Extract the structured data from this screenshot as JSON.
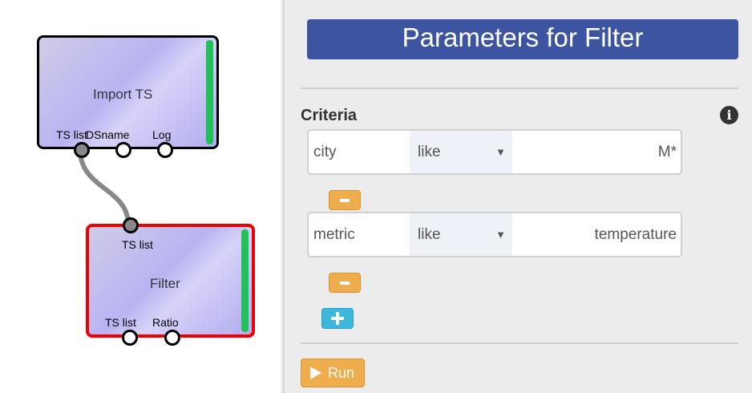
{
  "graph": {
    "nodes": [
      {
        "title": "Import TS",
        "ports_out": [
          "TS list",
          "DSname",
          "Log"
        ]
      },
      {
        "title": "Filter",
        "ports_in": [
          "TS list"
        ],
        "ports_out": [
          "TS list",
          "Ratio"
        ]
      }
    ]
  },
  "panel": {
    "title": "Parameters for Filter",
    "section_title": "Criteria",
    "info_icon": "i",
    "criteria": [
      {
        "field": "city",
        "operator": "like",
        "value": "M*"
      },
      {
        "field": "metric",
        "operator": "like",
        "value": "temperature"
      }
    ],
    "dropdown_arrow": "▼",
    "run_label": "Run"
  },
  "colors": {
    "panel_title_bg": "#3d54a1",
    "warning_button": "#f0ad4e",
    "info_button": "#3db7dc",
    "status_green": "#22c05a",
    "selected_node_border": "#ee0000"
  }
}
